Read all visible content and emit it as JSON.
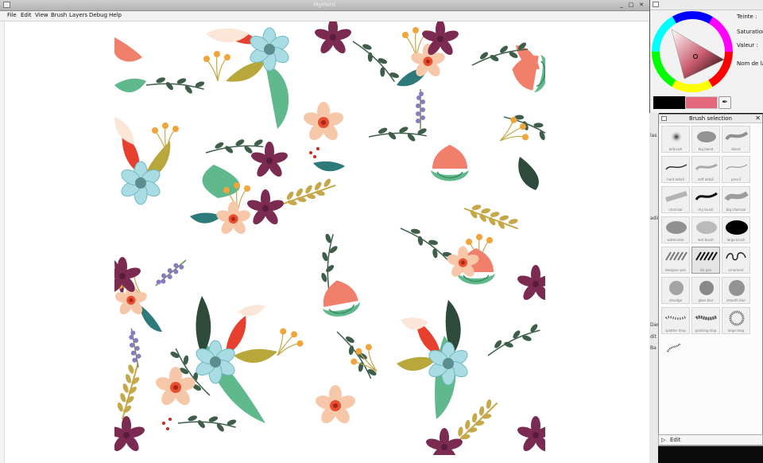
{
  "main_window": {
    "title": "MyPaint",
    "controls": {
      "minimize": "_",
      "maximize": "□",
      "close": "✕"
    },
    "menu": [
      "File",
      "Edit",
      "View",
      "Brush",
      "Layers",
      "Debug",
      "Help"
    ]
  },
  "color_window": {
    "labels": {
      "hue": "Teinte :",
      "saturation": "Saturation :",
      "value": "Valeur :",
      "name": "Nom de la c"
    },
    "foreground": "#000000",
    "background": "#e4687c",
    "picker_icon": "eyedropper-icon"
  },
  "left_edge_fragments": [
    "las",
    "adiu",
    "Dam",
    "dit",
    "Ba"
  ],
  "brush_window": {
    "title": "Brush selection",
    "close": "✕",
    "selected_index": 13,
    "brushes": [
      {
        "label": "airbrush"
      },
      {
        "label": "big blend"
      },
      {
        "label": "blend"
      },
      {
        "label": "hard detail"
      },
      {
        "label": "soft detail"
      },
      {
        "label": "pencil"
      },
      {
        "label": "charcoal"
      },
      {
        "label": "dry brush"
      },
      {
        "label": "big charcoal"
      },
      {
        "label": "watercolor"
      },
      {
        "label": "wet brush"
      },
      {
        "label": "large brush"
      },
      {
        "label": "designer pen"
      },
      {
        "label": "ink pen"
      },
      {
        "label": "ornament"
      },
      {
        "label": "smudge"
      },
      {
        "label": "glass blur"
      },
      {
        "label": "smooth blur"
      },
      {
        "label": "splatter drop"
      },
      {
        "label": "painting drop"
      },
      {
        "label": "large drop"
      },
      {
        "label": ""
      }
    ],
    "edit_label": "Edit"
  }
}
